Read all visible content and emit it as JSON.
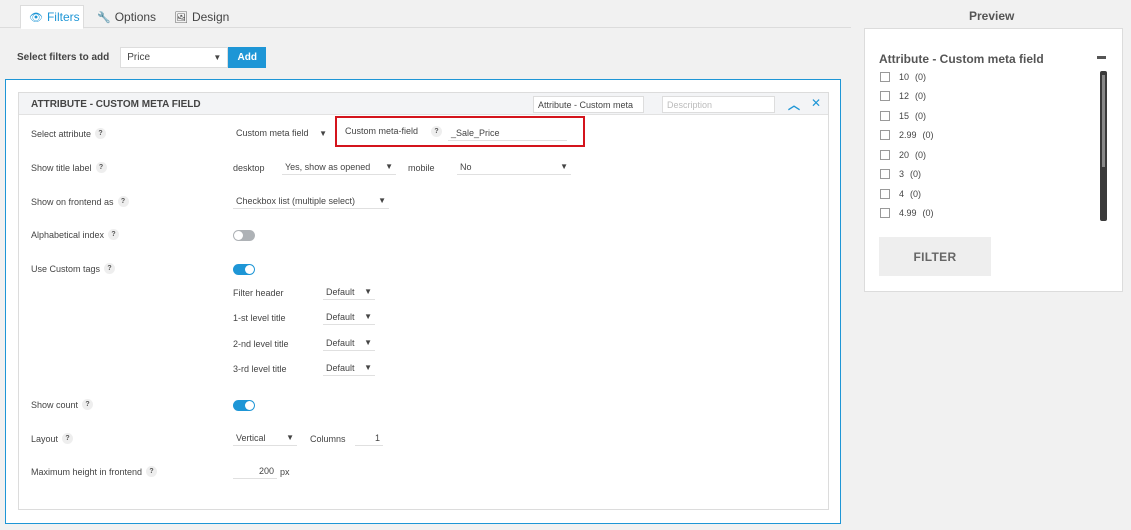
{
  "tabs": [
    {
      "label": "Filters",
      "icon": "eye-icon"
    },
    {
      "label": "Options",
      "icon": "wrench-icon"
    },
    {
      "label": "Design",
      "icon": "image-icon"
    }
  ],
  "preview_heading": "Preview",
  "select_filters": {
    "label": "Select filters to add",
    "value": "Price",
    "add_label": "Add"
  },
  "panel": {
    "title": "ATTRIBUTE - CUSTOM META FIELD",
    "title_input_value": "Attribute - Custom meta",
    "description_placeholder": "Description",
    "rows": {
      "select_attribute": {
        "label": "Select attribute",
        "value": "Custom meta field",
        "meta_label": "Custom meta-field",
        "meta_value": "_Sale_Price"
      },
      "show_title_label": {
        "label": "Show title label",
        "desktop_label": "desktop",
        "desktop_value": "Yes, show as opened",
        "mobile_label": "mobile",
        "mobile_value": "No"
      },
      "show_on_frontend": {
        "label": "Show on frontend as",
        "value": "Checkbox list (multiple select)"
      },
      "alphabetical_index": {
        "label": "Alphabetical index",
        "enabled": false
      },
      "use_custom_tags": {
        "label": "Use Custom tags",
        "enabled": true
      },
      "custom_tags": [
        {
          "label": "Filter header",
          "value": "Default"
        },
        {
          "label": "1-st level title",
          "value": "Default"
        },
        {
          "label": "2-nd level title",
          "value": "Default"
        },
        {
          "label": "3-rd level title",
          "value": "Default"
        }
      ],
      "show_count": {
        "label": "Show count",
        "enabled": true
      },
      "layout": {
        "label": "Layout",
        "value": "Vertical",
        "columns_label": "Columns",
        "columns_value": "1"
      },
      "max_height": {
        "label": "Maximum height in frontend",
        "value": "200",
        "unit": "px"
      }
    },
    "help_glyph": "?"
  },
  "preview": {
    "title": "Attribute - Custom meta field",
    "items": [
      {
        "value": "10",
        "count": "(0)"
      },
      {
        "value": "12",
        "count": "(0)"
      },
      {
        "value": "15",
        "count": "(0)"
      },
      {
        "value": "2.99",
        "count": "(0)"
      },
      {
        "value": "20",
        "count": "(0)"
      },
      {
        "value": "3",
        "count": "(0)"
      },
      {
        "value": "4",
        "count": "(0)"
      },
      {
        "value": "4.99",
        "count": "(0)"
      }
    ],
    "filter_button": "FILTER"
  },
  "colors": {
    "accent": "#1e96d6",
    "highlight": "#d4141c"
  }
}
